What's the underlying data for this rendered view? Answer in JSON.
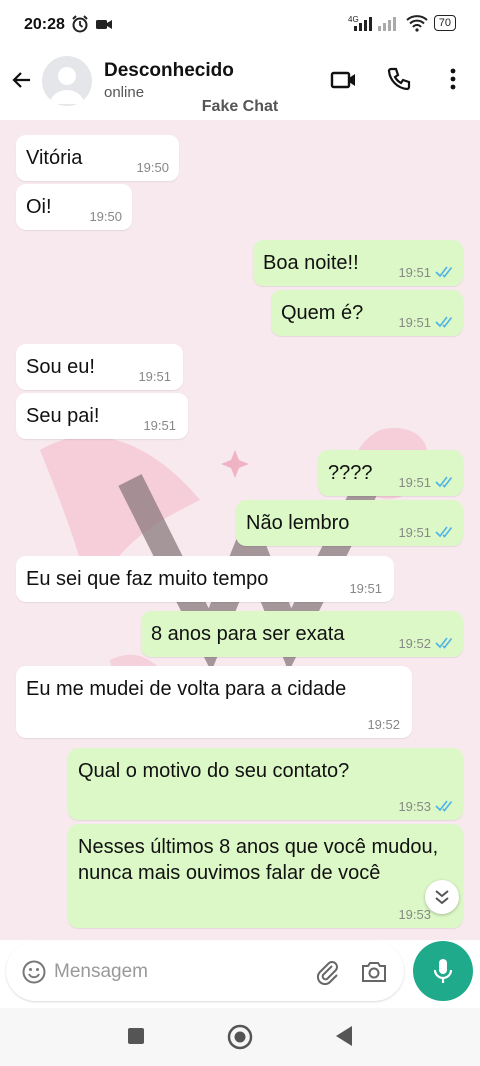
{
  "status_bar": {
    "time": "20:28",
    "battery": "70",
    "network": "4G"
  },
  "header": {
    "contact_name": "Desconhecido",
    "contact_status": "online"
  },
  "watermark": "Fake Chat",
  "messages": [
    {
      "dir": "in",
      "text": "Vitória",
      "time": "19:50"
    },
    {
      "dir": "in",
      "text": "Oi!",
      "time": "19:50"
    },
    {
      "dir": "out",
      "text": "Boa noite!!",
      "time": "19:51"
    },
    {
      "dir": "out",
      "text": "Quem é?",
      "time": "19:51"
    },
    {
      "dir": "in",
      "text": "Sou eu!",
      "time": "19:51"
    },
    {
      "dir": "in",
      "text": "Seu pai!",
      "time": "19:51"
    },
    {
      "dir": "out",
      "text": "????",
      "time": "19:51"
    },
    {
      "dir": "out",
      "text": "Não lembro",
      "time": "19:51"
    },
    {
      "dir": "in",
      "text": "Eu sei que faz muito tempo",
      "time": "19:51"
    },
    {
      "dir": "out",
      "text": "8 anos para ser exata",
      "time": "19:52"
    },
    {
      "dir": "in",
      "text": "Eu me mudei de volta para a cidade",
      "time": "19:52"
    },
    {
      "dir": "out",
      "text": "Qual o motivo do seu contato?",
      "time": "19:53"
    },
    {
      "dir": "out",
      "text": "Nesses últimos 8 anos que você mudou, nunca mais ouvimos falar de você",
      "time": "19:53"
    }
  ],
  "composer": {
    "placeholder": "Mensagem"
  },
  "colors": {
    "incoming": "#ffffff",
    "outgoing": "#dcf8c6",
    "chat_bg": "#f8e9ef",
    "accent": "#1faa8b",
    "read_ticks": "#4fb3e8"
  },
  "icons": [
    "alarm-icon",
    "video-record-icon",
    "signal-icon",
    "wifi-icon",
    "back-arrow-icon",
    "video-call-icon",
    "phone-icon",
    "more-vert-icon",
    "double-chevron-down-icon",
    "emoji-icon",
    "attach-icon",
    "camera-icon",
    "mic-icon",
    "nav-square-icon",
    "nav-circle-icon",
    "nav-back-icon"
  ]
}
